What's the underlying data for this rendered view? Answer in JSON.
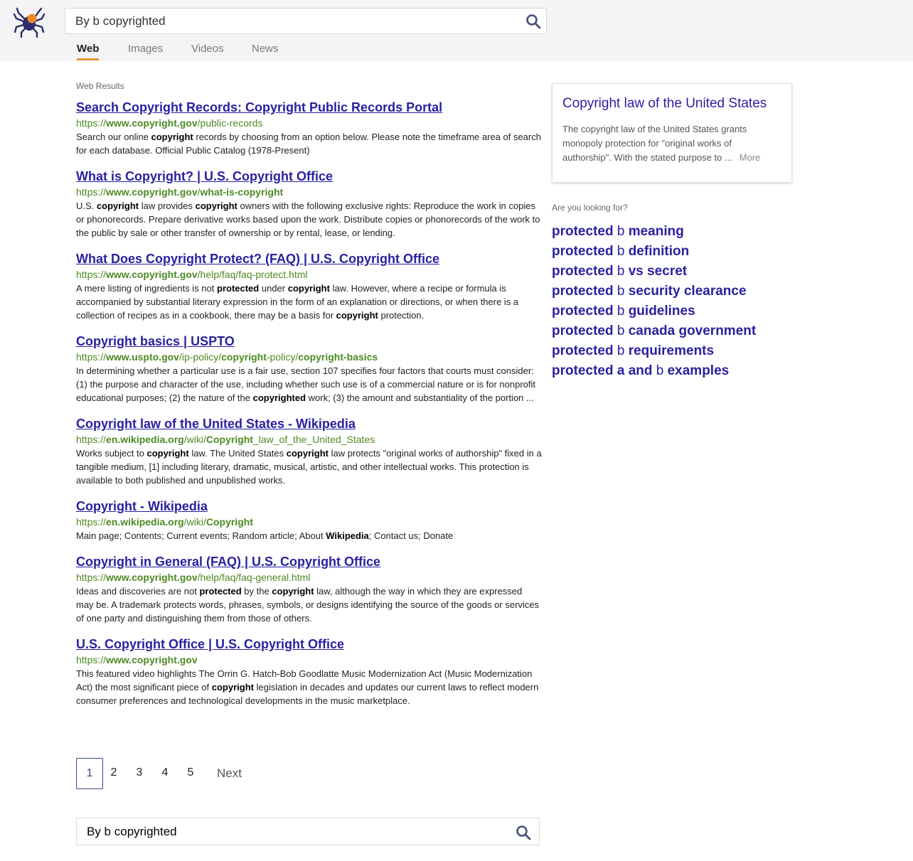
{
  "search": {
    "query": "By b copyrighted"
  },
  "tabs": [
    "Web",
    "Images",
    "Videos",
    "News"
  ],
  "active_tab": "Web",
  "results_label": "Web Results",
  "results": [
    {
      "title": "Search Copyright Records: Copyright Public Records Portal",
      "url": [
        [
          "https://",
          false
        ],
        [
          "www.copyright.gov",
          true
        ],
        [
          "/public-records",
          false
        ]
      ],
      "snippet": [
        [
          "Search our online ",
          false
        ],
        [
          "copyright",
          true
        ],
        [
          " records by choosing from an option below. Please note the timeframe area of search for each database. Official Public Catalog (1978-Present)",
          false
        ]
      ]
    },
    {
      "title": "What is Copyright? | U.S. Copyright Office",
      "url": [
        [
          "https://",
          false
        ],
        [
          "www.copyright.gov",
          true
        ],
        [
          "/",
          false
        ],
        [
          "what-is-copyright",
          true
        ]
      ],
      "snippet": [
        [
          "U.S. ",
          false
        ],
        [
          "copyright",
          true
        ],
        [
          " law provides ",
          false
        ],
        [
          "copyright",
          true
        ],
        [
          " owners with the following exclusive rights: Reproduce the work in copies or phonorecords. Prepare derivative works based upon the work. Distribute copies or phonorecords of the work to the public by sale or other transfer of ownership or by rental, lease, or lending.",
          false
        ]
      ]
    },
    {
      "title": "What Does Copyright Protect? (FAQ) | U.S. Copyright Office",
      "url": [
        [
          "https://",
          false
        ],
        [
          "www.copyright.gov",
          true
        ],
        [
          "/help/faq/faq-protect.html",
          false
        ]
      ],
      "snippet": [
        [
          "A mere listing of ingredients is not ",
          false
        ],
        [
          "protected",
          true
        ],
        [
          " under ",
          false
        ],
        [
          "copyright",
          true
        ],
        [
          " law. However, where a recipe or formula is accompanied by substantial literary expression in the form of an explanation or directions, or when there is a collection of recipes as in a cookbook, there may be a basis for ",
          false
        ],
        [
          "copyright",
          true
        ],
        [
          " protection.",
          false
        ]
      ]
    },
    {
      "title": "Copyright basics | USPTO",
      "url": [
        [
          "https://",
          false
        ],
        [
          "www.uspto.gov",
          true
        ],
        [
          "/ip-policy/",
          false
        ],
        [
          "copyright",
          true
        ],
        [
          "-policy/",
          false
        ],
        [
          "copyright-basics",
          true
        ]
      ],
      "snippet": [
        [
          "In determining whether a particular use is a fair use, section 107 specifies four factors that courts must consider: (1) the purpose and character of the use, including whether such use is of a commercial nature or is for nonprofit educational purposes; (2) the nature of the ",
          false
        ],
        [
          "copyrighted",
          true
        ],
        [
          " work; (3) the amount and substantiality of the portion ...",
          false
        ]
      ]
    },
    {
      "title": "Copyright law of the United States - Wikipedia",
      "url": [
        [
          "https://",
          false
        ],
        [
          "en.wikipedia.org",
          true
        ],
        [
          "/wiki/",
          false
        ],
        [
          "Copyright",
          true
        ],
        [
          "_law_of_the_United_States",
          false
        ]
      ],
      "snippet": [
        [
          "Works subject to ",
          false
        ],
        [
          "copyright",
          true
        ],
        [
          " law. The United States ",
          false
        ],
        [
          "copyright",
          true
        ],
        [
          " law protects \"original works of authorship\" fixed in a tangible medium, [1] including literary, dramatic, musical, artistic, and other intellectual works. This protection is available to both published and unpublished works.",
          false
        ]
      ]
    },
    {
      "title": "Copyright - Wikipedia",
      "url": [
        [
          "https://",
          false
        ],
        [
          "en.wikipedia.org",
          true
        ],
        [
          "/wiki/",
          false
        ],
        [
          "Copyright",
          true
        ]
      ],
      "snippet": [
        [
          "Main page; Contents; Current events; Random article; About ",
          false
        ],
        [
          "Wikipedia",
          true
        ],
        [
          "; Contact us; Donate",
          false
        ]
      ]
    },
    {
      "title": "Copyright in General (FAQ) | U.S. Copyright Office",
      "url": [
        [
          "https://",
          false
        ],
        [
          "www.copyright.gov",
          true
        ],
        [
          "/help/faq/faq-general.html",
          false
        ]
      ],
      "snippet": [
        [
          "Ideas and discoveries are not ",
          false
        ],
        [
          "protected",
          true
        ],
        [
          " by the ",
          false
        ],
        [
          "copyright",
          true
        ],
        [
          " law, although the way in which they are expressed may be. A trademark protects words, phrases, symbols, or designs identifying the source of the goods or services of one party and distinguishing them from those of others.",
          false
        ]
      ]
    },
    {
      "title": "U.S. Copyright Office | U.S. Copyright Office",
      "url": [
        [
          "https://",
          false
        ],
        [
          "www.copyright.gov",
          true
        ]
      ],
      "snippet": [
        [
          "This featured video highlights The Orrin G. Hatch-Bob Goodlatte Music Modernization Act (Music Modernization Act) the most significant piece of ",
          false
        ],
        [
          "copyright",
          true
        ],
        [
          " legislation in decades and updates our current laws to reflect modern consumer preferences and technological developments in the music marketplace.",
          false
        ]
      ]
    }
  ],
  "pagination": {
    "pages": [
      "1",
      "2",
      "3",
      "4",
      "5"
    ],
    "current": "1",
    "next_label": "Next"
  },
  "knowledge_panel": {
    "title": "Copyright law of the United States",
    "text": "The copyright law of the United States grants monopoly protection for \"original works of authorship\". With the stated purpose to ...",
    "more_label": "More"
  },
  "related_label": "Are you looking for?",
  "related": [
    [
      [
        "protected",
        true
      ],
      [
        " b ",
        false
      ],
      [
        "meaning",
        true
      ]
    ],
    [
      [
        "protected",
        true
      ],
      [
        " b ",
        false
      ],
      [
        "definition",
        true
      ]
    ],
    [
      [
        "protected",
        true
      ],
      [
        " b ",
        false
      ],
      [
        "vs secret",
        true
      ]
    ],
    [
      [
        "protected",
        true
      ],
      [
        " b ",
        false
      ],
      [
        "security clearance",
        true
      ]
    ],
    [
      [
        "protected",
        true
      ],
      [
        " b ",
        false
      ],
      [
        "guidelines",
        true
      ]
    ],
    [
      [
        "protected",
        true
      ],
      [
        " b ",
        false
      ],
      [
        "canada government",
        true
      ]
    ],
    [
      [
        "protected",
        true
      ],
      [
        " b ",
        false
      ],
      [
        "requirements",
        true
      ]
    ],
    [
      [
        "protected a and",
        true
      ],
      [
        " b ",
        false
      ],
      [
        "examples",
        true
      ]
    ]
  ],
  "colors": {
    "brand_accent": "#e8962f",
    "link": "#2a1fa0",
    "url_green": "#4d8a24",
    "header_bg": "#f4f4f6"
  }
}
